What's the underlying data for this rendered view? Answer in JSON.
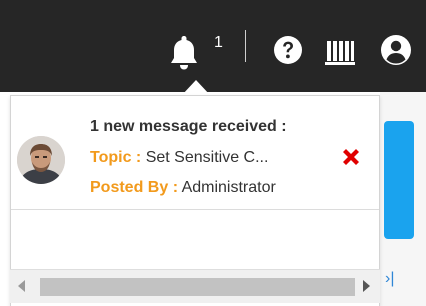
{
  "topbar": {
    "notification_count": "1",
    "icons": {
      "bell": "bell-icon",
      "help": "help-circle-icon",
      "library": "library-icon",
      "user": "user-icon"
    }
  },
  "notification": {
    "title": "1 new message received :",
    "topic_label": "Topic :",
    "topic_value": "Set Sensitive C...",
    "posted_by_label": "Posted By :",
    "posted_by_value": "Administrator",
    "close_icon": "close-icon"
  },
  "colors": {
    "topbar_bg": "#262626",
    "label_orange": "#f29a1c",
    "close_red": "#e00000",
    "accent_blue": "#1aa3ee"
  },
  "right_edge": {
    "chevron": "›|"
  }
}
